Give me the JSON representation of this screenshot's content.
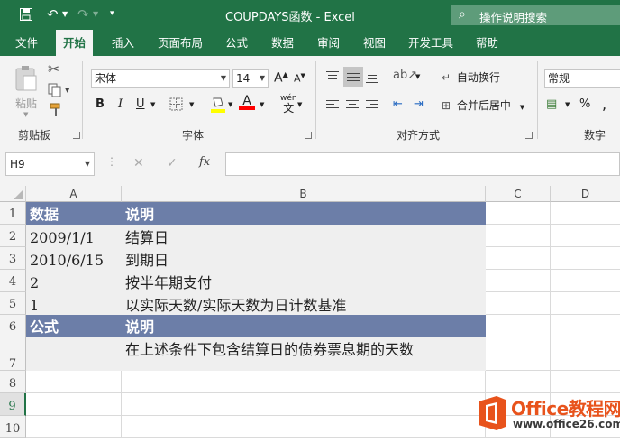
{
  "title_bar": {
    "window_title": "COUPDAYS函数 - Excel",
    "search_placeholder": "操作说明搜索"
  },
  "tabs": [
    {
      "label": "文件",
      "active": false
    },
    {
      "label": "开始",
      "active": true
    },
    {
      "label": "插入",
      "active": false
    },
    {
      "label": "页面布局",
      "active": false
    },
    {
      "label": "公式",
      "active": false
    },
    {
      "label": "数据",
      "active": false
    },
    {
      "label": "审阅",
      "active": false
    },
    {
      "label": "视图",
      "active": false
    },
    {
      "label": "开发工具",
      "active": false
    },
    {
      "label": "帮助",
      "active": false
    }
  ],
  "ribbon": {
    "clipboard": {
      "paste_label": "粘贴",
      "group_label": "剪贴板"
    },
    "font": {
      "font_name": "宋体",
      "font_size": "14",
      "bold": "B",
      "italic": "I",
      "underline": "U",
      "fill_letter": "A",
      "wen_label": "wén",
      "wen_char": "文",
      "group_label": "字体",
      "grow_label": "A",
      "shrink_label": "A"
    },
    "alignment": {
      "wrap_label": "自动换行",
      "merge_label": "合并后居中",
      "group_label": "对齐方式"
    },
    "number": {
      "format": "常规",
      "percent": "%",
      "comma": ",",
      "group_label": "数字"
    }
  },
  "formula_bar": {
    "name_box": "H9",
    "fx": "fx",
    "formula": ""
  },
  "columns": [
    "A",
    "B",
    "C",
    "D"
  ],
  "rows": [
    "1",
    "2",
    "3",
    "4",
    "5",
    "6",
    "7",
    "8",
    "9",
    "10"
  ],
  "selected_row": "9",
  "cells": {
    "A1": "数据",
    "B1": "说明",
    "A2": "2009/1/1",
    "B2": "结算日",
    "A3": "2010/6/15",
    "B3": "到期日",
    "A4": "2",
    "B4": "按半年期支付",
    "A5": "1",
    "B5": "以实际天数/实际天数为日计数基准",
    "A6": "公式",
    "B6": "说明",
    "A7": "",
    "B7": "在上述条件下包含结算日的债券票息期的天数"
  },
  "colors": {
    "accent": "#217346",
    "header_fill": "#6c7ea8",
    "data_fill": "#efefef",
    "watermark_orange": "#e8531c"
  },
  "watermark": {
    "brand": "Office教程网",
    "url": "www.office26.com"
  }
}
